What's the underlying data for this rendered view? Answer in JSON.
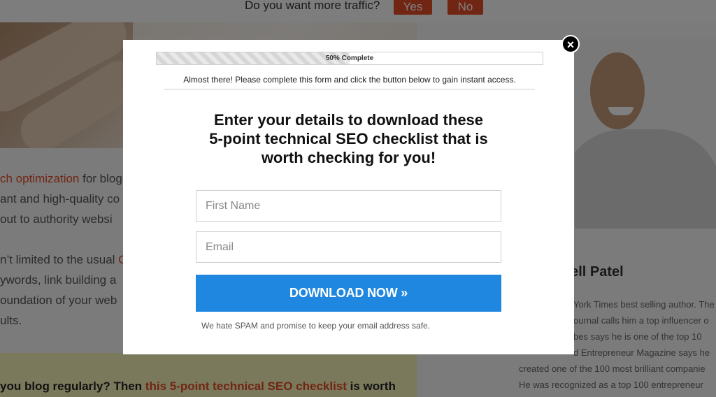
{
  "topbar": {
    "question": "Do you want more traffic?",
    "yes_label": "Yes",
    "no_label": "No"
  },
  "article": {
    "lines": [
      {
        "pre": "",
        "link": "ch optimization",
        "post": " for blog"
      },
      {
        "pre": "ant and high-quality co",
        "link": "",
        "post": ""
      },
      {
        "pre": "out to authority websi",
        "link": "",
        "post": ""
      },
      {
        "pre": "n’t limited to the usual ",
        "link": "C",
        "post": ""
      },
      {
        "pre": "ywords, link building a",
        "link": "",
        "post": ""
      },
      {
        "pre": "oundation of your web",
        "link": "",
        "post": ""
      },
      {
        "pre": "ults.",
        "link": "",
        "post": ""
      }
    ],
    "callout_pre": "you blog regularly? Then ",
    "callout_link": "this 5-point technical SEO checklist",
    "callout_post": " is worth"
  },
  "sidebar": {
    "author_name": "Jell Patel",
    "bio_lines": [
      "York Times best selling author. The",
      "ournal calls him a top influencer o",
      "bes says he is one of the top 10",
      "d Entrepreneur Magazine says he",
      "created one of the 100 most brilliant companie",
      "He was recognized as a top 100 entrepreneur"
    ]
  },
  "modal": {
    "close_glyph": "×",
    "progress": {
      "percent": 50,
      "label": "50% Complete"
    },
    "notice": "Almost there! Please complete this form and click the button below to gain instant access.",
    "title_lines": [
      "Enter your details to download  these",
      "5-point technical SEO checklist that is",
      "worth checking for you!"
    ],
    "first_name": {
      "value": "",
      "placeholder": "First Name"
    },
    "email": {
      "value": "",
      "placeholder": "Email"
    },
    "download_label": "DOWNLOAD NOW »",
    "spam_note": "We hate SPAM and promise to keep your email address safe."
  },
  "colors": {
    "accent_orange": "#e24b26",
    "button_blue": "#1f87e0",
    "callout_yellow": "#f5f2b8"
  }
}
